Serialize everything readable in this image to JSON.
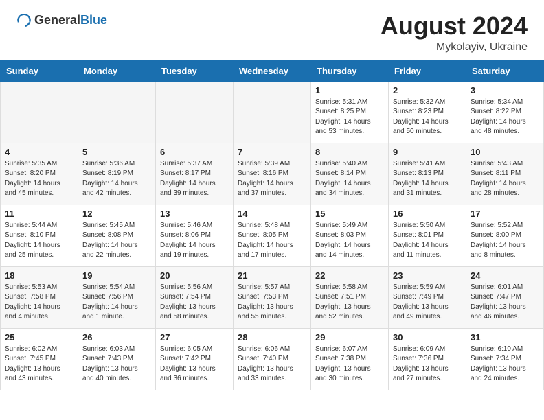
{
  "header": {
    "logo_general": "General",
    "logo_blue": "Blue",
    "title": "August 2024",
    "location": "Mykolayiv, Ukraine"
  },
  "weekdays": [
    "Sunday",
    "Monday",
    "Tuesday",
    "Wednesday",
    "Thursday",
    "Friday",
    "Saturday"
  ],
  "weeks": [
    [
      {
        "day": "",
        "info": ""
      },
      {
        "day": "",
        "info": ""
      },
      {
        "day": "",
        "info": ""
      },
      {
        "day": "",
        "info": ""
      },
      {
        "day": "1",
        "info": "Sunrise: 5:31 AM\nSunset: 8:25 PM\nDaylight: 14 hours\nand 53 minutes."
      },
      {
        "day": "2",
        "info": "Sunrise: 5:32 AM\nSunset: 8:23 PM\nDaylight: 14 hours\nand 50 minutes."
      },
      {
        "day": "3",
        "info": "Sunrise: 5:34 AM\nSunset: 8:22 PM\nDaylight: 14 hours\nand 48 minutes."
      }
    ],
    [
      {
        "day": "4",
        "info": "Sunrise: 5:35 AM\nSunset: 8:20 PM\nDaylight: 14 hours\nand 45 minutes."
      },
      {
        "day": "5",
        "info": "Sunrise: 5:36 AM\nSunset: 8:19 PM\nDaylight: 14 hours\nand 42 minutes."
      },
      {
        "day": "6",
        "info": "Sunrise: 5:37 AM\nSunset: 8:17 PM\nDaylight: 14 hours\nand 39 minutes."
      },
      {
        "day": "7",
        "info": "Sunrise: 5:39 AM\nSunset: 8:16 PM\nDaylight: 14 hours\nand 37 minutes."
      },
      {
        "day": "8",
        "info": "Sunrise: 5:40 AM\nSunset: 8:14 PM\nDaylight: 14 hours\nand 34 minutes."
      },
      {
        "day": "9",
        "info": "Sunrise: 5:41 AM\nSunset: 8:13 PM\nDaylight: 14 hours\nand 31 minutes."
      },
      {
        "day": "10",
        "info": "Sunrise: 5:43 AM\nSunset: 8:11 PM\nDaylight: 14 hours\nand 28 minutes."
      }
    ],
    [
      {
        "day": "11",
        "info": "Sunrise: 5:44 AM\nSunset: 8:10 PM\nDaylight: 14 hours\nand 25 minutes."
      },
      {
        "day": "12",
        "info": "Sunrise: 5:45 AM\nSunset: 8:08 PM\nDaylight: 14 hours\nand 22 minutes."
      },
      {
        "day": "13",
        "info": "Sunrise: 5:46 AM\nSunset: 8:06 PM\nDaylight: 14 hours\nand 19 minutes."
      },
      {
        "day": "14",
        "info": "Sunrise: 5:48 AM\nSunset: 8:05 PM\nDaylight: 14 hours\nand 17 minutes."
      },
      {
        "day": "15",
        "info": "Sunrise: 5:49 AM\nSunset: 8:03 PM\nDaylight: 14 hours\nand 14 minutes."
      },
      {
        "day": "16",
        "info": "Sunrise: 5:50 AM\nSunset: 8:01 PM\nDaylight: 14 hours\nand 11 minutes."
      },
      {
        "day": "17",
        "info": "Sunrise: 5:52 AM\nSunset: 8:00 PM\nDaylight: 14 hours\nand 8 minutes."
      }
    ],
    [
      {
        "day": "18",
        "info": "Sunrise: 5:53 AM\nSunset: 7:58 PM\nDaylight: 14 hours\nand 4 minutes."
      },
      {
        "day": "19",
        "info": "Sunrise: 5:54 AM\nSunset: 7:56 PM\nDaylight: 14 hours\nand 1 minute."
      },
      {
        "day": "20",
        "info": "Sunrise: 5:56 AM\nSunset: 7:54 PM\nDaylight: 13 hours\nand 58 minutes."
      },
      {
        "day": "21",
        "info": "Sunrise: 5:57 AM\nSunset: 7:53 PM\nDaylight: 13 hours\nand 55 minutes."
      },
      {
        "day": "22",
        "info": "Sunrise: 5:58 AM\nSunset: 7:51 PM\nDaylight: 13 hours\nand 52 minutes."
      },
      {
        "day": "23",
        "info": "Sunrise: 5:59 AM\nSunset: 7:49 PM\nDaylight: 13 hours\nand 49 minutes."
      },
      {
        "day": "24",
        "info": "Sunrise: 6:01 AM\nSunset: 7:47 PM\nDaylight: 13 hours\nand 46 minutes."
      }
    ],
    [
      {
        "day": "25",
        "info": "Sunrise: 6:02 AM\nSunset: 7:45 PM\nDaylight: 13 hours\nand 43 minutes."
      },
      {
        "day": "26",
        "info": "Sunrise: 6:03 AM\nSunset: 7:43 PM\nDaylight: 13 hours\nand 40 minutes."
      },
      {
        "day": "27",
        "info": "Sunrise: 6:05 AM\nSunset: 7:42 PM\nDaylight: 13 hours\nand 36 minutes."
      },
      {
        "day": "28",
        "info": "Sunrise: 6:06 AM\nSunset: 7:40 PM\nDaylight: 13 hours\nand 33 minutes."
      },
      {
        "day": "29",
        "info": "Sunrise: 6:07 AM\nSunset: 7:38 PM\nDaylight: 13 hours\nand 30 minutes."
      },
      {
        "day": "30",
        "info": "Sunrise: 6:09 AM\nSunset: 7:36 PM\nDaylight: 13 hours\nand 27 minutes."
      },
      {
        "day": "31",
        "info": "Sunrise: 6:10 AM\nSunset: 7:34 PM\nDaylight: 13 hours\nand 24 minutes."
      }
    ]
  ]
}
